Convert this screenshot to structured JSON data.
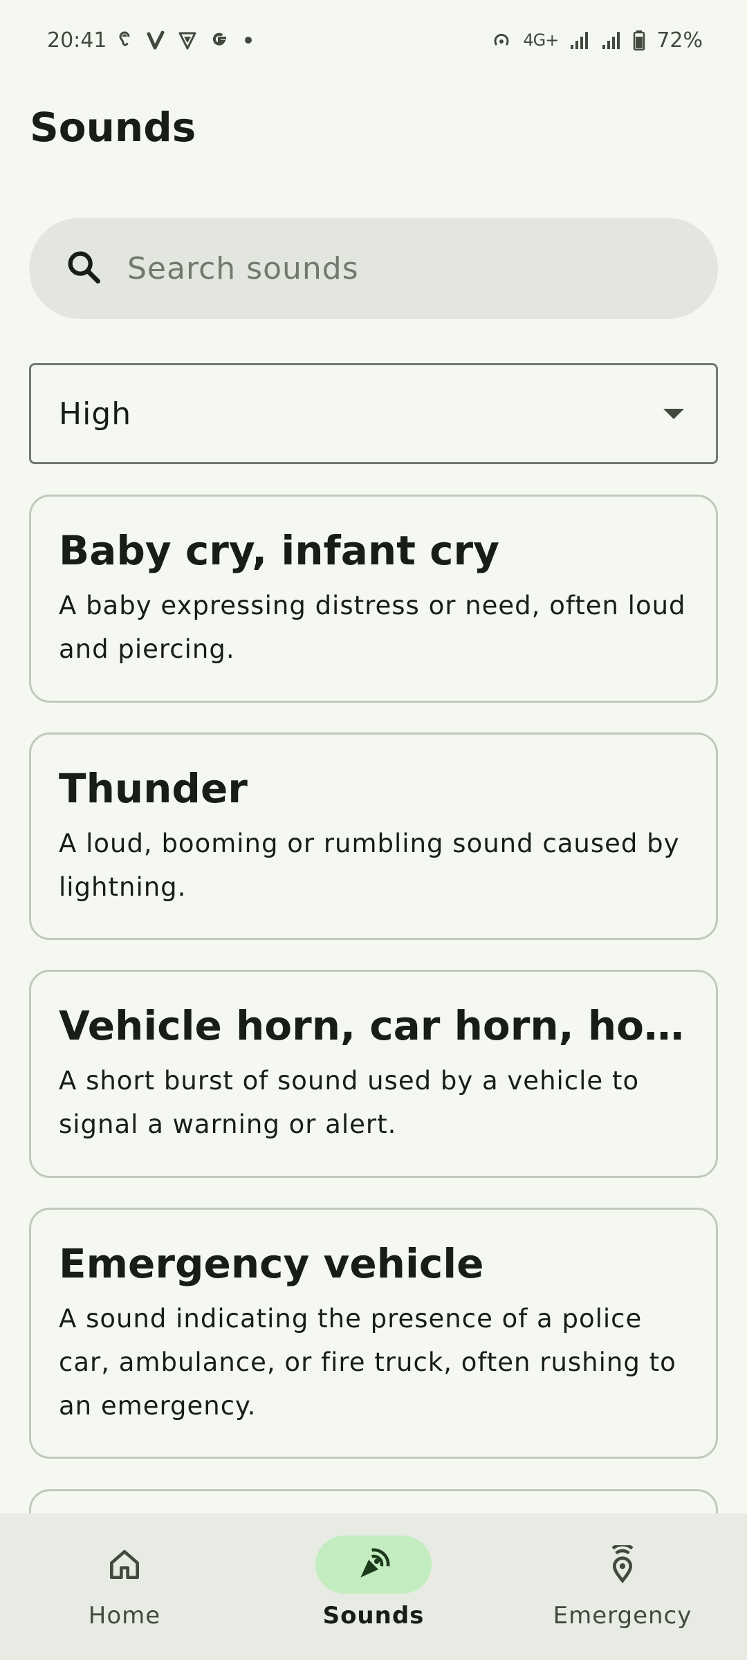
{
  "status_bar": {
    "time": "20:41",
    "network": "4G+",
    "battery": "72%"
  },
  "page_title": "Sounds",
  "search": {
    "placeholder": "Search sounds",
    "value": ""
  },
  "filter": {
    "selected": "High"
  },
  "sounds": [
    {
      "title": "Baby cry, infant cry",
      "description": "A baby expressing distress or need, often loud and piercing."
    },
    {
      "title": "Thunder",
      "description": "A loud, booming or rumbling sound caused by lightning."
    },
    {
      "title": "Vehicle horn, car horn, honking",
      "description": "A short burst of sound used by a vehicle to signal a warning or alert."
    },
    {
      "title": "Emergency vehicle",
      "description": "A sound indicating the presence of a police car, ambulance, or fire truck, often rushing to an emergency."
    }
  ],
  "nav": {
    "items": [
      {
        "label": "Home",
        "icon": "home-icon"
      },
      {
        "label": "Sounds",
        "icon": "sounds-icon",
        "active": true
      },
      {
        "label": "Emergency",
        "icon": "emergency-icon"
      }
    ]
  },
  "colors": {
    "background": "#F4F8F1",
    "accent": "#C3EDC0",
    "surface": "#E2E6DE",
    "nav_bg": "#E8EBE3",
    "outline": "#72796F"
  }
}
